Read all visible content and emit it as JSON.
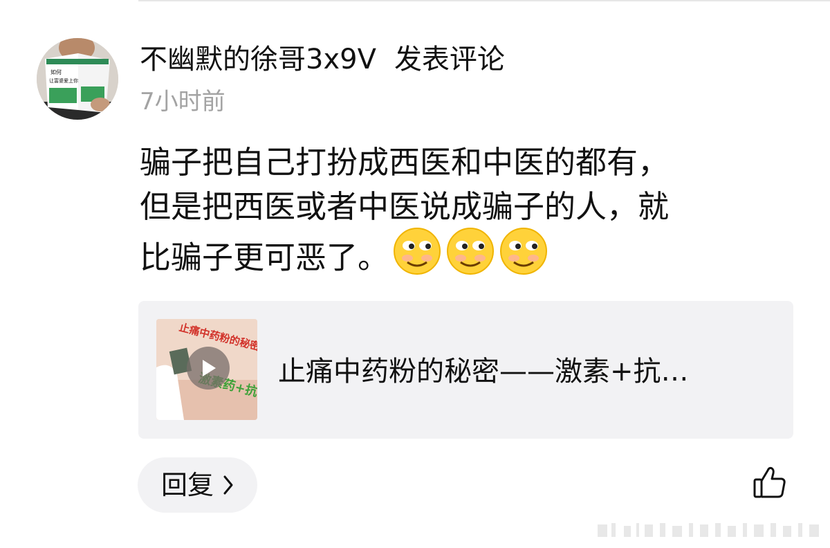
{
  "comment": {
    "author": "不幽默的徐哥3x9V",
    "action": "发表评论",
    "time": "7小时前",
    "text_lines": [
      "骗子把自己打扮成西医和中医的都有，",
      "但是把西医或者中医说成骗子的人，就",
      "比骗子更可恶了。"
    ],
    "emojis": [
      "smile-emoji",
      "smile-emoji",
      "smile-emoji"
    ]
  },
  "avatar": {
    "book_text_line1": "如何",
    "book_text_line2": "让富婆爱上你"
  },
  "link_card": {
    "title": "止痛中药粉的秘密——激素+抗…",
    "thumbnail_text": "止痛中药粉的秘密",
    "thumbnail_text2": "激素药+抗"
  },
  "actions": {
    "reply_label": "回复",
    "reply_icon": "chevron-right-icon",
    "like_icon": "thumbs-up-icon"
  },
  "colors": {
    "background": "#ffffff",
    "card_background": "#f2f2f4",
    "muted_text": "#a3a3a3",
    "primary_text": "#111111"
  }
}
